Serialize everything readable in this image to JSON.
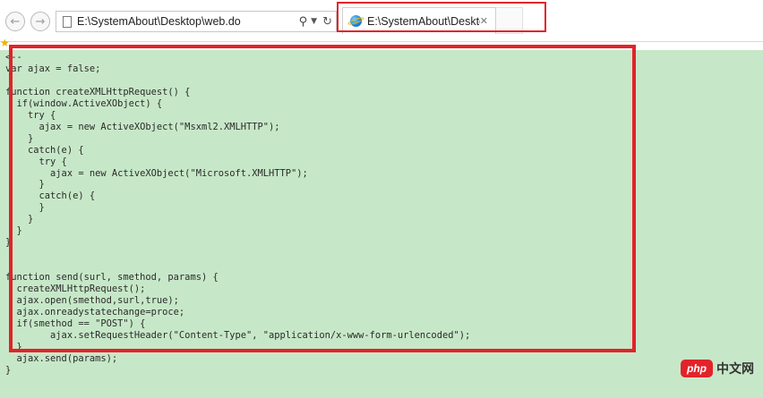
{
  "browser": {
    "address": "E:\\SystemAbout\\Desktop\\web.do",
    "tab_title": "E:\\SystemAbout\\Desktop...",
    "icons": {
      "back": "back-arrow-icon",
      "forward": "forward-arrow-icon",
      "page": "page-icon",
      "search": "search-icon",
      "dropdown": "chevron-down-icon",
      "refresh": "refresh-icon",
      "tab": "ie-logo-icon",
      "close": "close-icon",
      "favorites": "star-icon"
    },
    "highlight_color": "#e2232a"
  },
  "content": {
    "background": "#c7e8c8",
    "code_lines": [
      "<--",
      "var ajax = false;",
      "",
      "function createXMLHttpRequest() {",
      "  if(window.ActiveXObject) {",
      "    try {",
      "      ajax = new ActiveXObject(\"Msxml2.XMLHTTP\");",
      "    }",
      "    catch(e) {",
      "      try {",
      "        ajax = new ActiveXObject(\"Microsoft.XMLHTTP\");",
      "      }",
      "      catch(e) {",
      "      }",
      "    }",
      "  }",
      "}",
      "",
      "",
      "function send(surl, smethod, params) {",
      "  createXMLHttpRequest();",
      "  ajax.open(smethod,surl,true);",
      "  ajax.onreadystatechange=proce;",
      "  if(smethod == \"POST\") {",
      "        ajax.setRequestHeader(\"Content-Type\", \"application/x-www-form-urlencoded\");",
      "  }",
      "  ajax.send(params);",
      "}"
    ]
  },
  "watermark": {
    "logo": "php",
    "text": "中文网"
  }
}
